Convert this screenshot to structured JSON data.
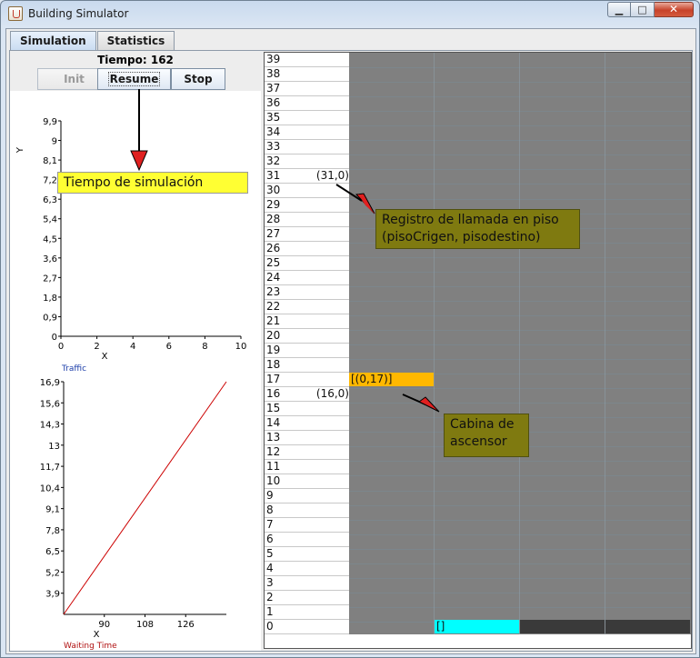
{
  "window": {
    "title": "Building Simulator"
  },
  "tabs": [
    {
      "label": "Simulation",
      "active": true
    },
    {
      "label": "Statistics",
      "active": false
    }
  ],
  "controls": {
    "tiempo_label": "Tiempo: 162",
    "init_label": "Init",
    "resume_label": "Resume",
    "stop_label": "Stop"
  },
  "traffic_chart": {
    "caption": "Traffic",
    "chart_data": {
      "type": "line",
      "title": "",
      "xlabel": "X",
      "ylabel": "Y",
      "xlim": [
        0,
        10
      ],
      "ylim": [
        0,
        9.9
      ],
      "x_ticks": [
        "0",
        "2",
        "4",
        "6",
        "8",
        "10"
      ],
      "y_ticks": [
        "0",
        "0,9",
        "1,8",
        "2,7",
        "3,6",
        "4,5",
        "5,4",
        "6,3",
        "7,2",
        "8,1",
        "9",
        "9,9"
      ],
      "series": []
    }
  },
  "waiting_chart": {
    "caption": "Waiting Time",
    "chart_data": {
      "type": "line",
      "title": "",
      "xlabel": "X",
      "ylabel": "",
      "xlim": [
        72,
        144
      ],
      "ylim": [
        2.6,
        16.9
      ],
      "x_ticks": [
        "90",
        "108",
        "126"
      ],
      "y_ticks": [
        "3,9",
        "5,2",
        "6,5",
        "7,8",
        "9,1",
        "10,4",
        "11,7",
        "13",
        "14,3",
        "15,6",
        "16,9"
      ],
      "series": [
        {
          "color": "#cc0000",
          "x": [
            72,
            144
          ],
          "y": [
            2.6,
            16.9
          ]
        }
      ]
    }
  },
  "building": {
    "floors": [
      "39",
      "38",
      "37",
      "36",
      "35",
      "34",
      "33",
      "32",
      "31",
      "30",
      "29",
      "28",
      "27",
      "26",
      "25",
      "24",
      "23",
      "22",
      "21",
      "20",
      "19",
      "18",
      "17",
      "16",
      "15",
      "14",
      "13",
      "12",
      "11",
      "10",
      "9",
      "8",
      "7",
      "6",
      "5",
      "4",
      "3",
      "2",
      "1",
      "0"
    ],
    "calls": [
      {
        "floor": "31",
        "text": "(31,0)"
      },
      {
        "floor": "16",
        "text": "(16,0)"
      }
    ],
    "cabins": [
      {
        "text": "[(0,17)]",
        "color": "#ffb800"
      },
      {
        "text": "[]",
        "color": "#00ffff"
      },
      {
        "text": "",
        "color": "#3a3a3a"
      },
      {
        "text": "",
        "color": "#3a3a3a"
      }
    ]
  },
  "annotations": {
    "tiempo": "Tiempo de simulación",
    "registro_line1": "Registro de llamada en piso",
    "registro_line2": "(pisoCrigen, pisodestino)",
    "cabina_line1": "Cabina de",
    "cabina_line2": "ascensor"
  },
  "colors": {
    "accent": "#ffff33",
    "note_olive": "#7f7a10",
    "arrow_red": "#e02020"
  }
}
